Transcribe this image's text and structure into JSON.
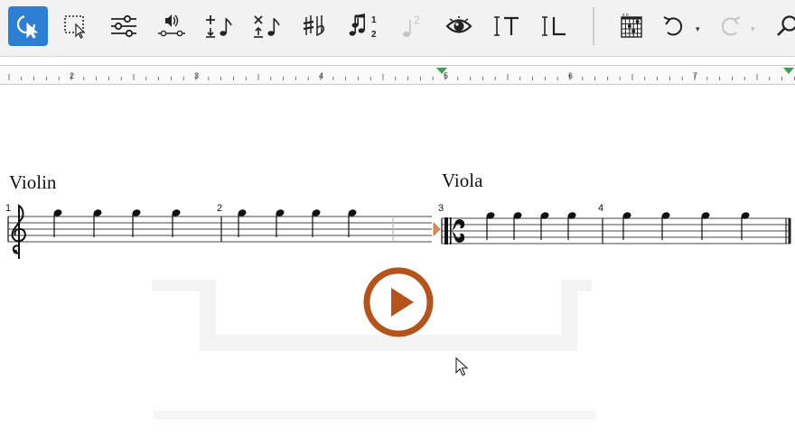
{
  "toolbar": {
    "tools": [
      {
        "name": "select-tool",
        "icon": "select-arrow-icon",
        "active": true
      },
      {
        "name": "range-select-tool",
        "icon": "range-select-icon"
      },
      {
        "name": "properties-tool",
        "icon": "sliders-icon"
      },
      {
        "name": "playback-tool",
        "icon": "speaker-icon"
      },
      {
        "name": "add-note-tool",
        "icon": "add-note-icon"
      },
      {
        "name": "remove-note-tool",
        "icon": "remove-note-icon"
      },
      {
        "name": "accidentals-tool",
        "icon": "accidentals-icon"
      },
      {
        "name": "voices-tool",
        "icon": "voices-icon",
        "labels": [
          "1",
          "2"
        ]
      },
      {
        "name": "voice-2-tool",
        "icon": "voice-2-icon",
        "disabled": true,
        "label": "2"
      },
      {
        "name": "visibility-tool",
        "icon": "eye-icon"
      },
      {
        "name": "text-tool",
        "icon": "text-insert-icon",
        "label": "T"
      },
      {
        "name": "lyrics-tool",
        "icon": "lyrics-insert-icon",
        "label": "L"
      },
      {
        "name": "chord-diagram-tool",
        "icon": "chord-grid-icon"
      },
      {
        "name": "undo-button",
        "icon": "undo-icon"
      },
      {
        "name": "redo-button",
        "icon": "redo-icon",
        "disabled": true
      },
      {
        "name": "search-button",
        "icon": "search-icon"
      }
    ],
    "caret": "▾"
  },
  "ruler": {
    "labels": [
      "2",
      "3",
      "4",
      "5",
      "6",
      "7"
    ],
    "marker_color": "#2ea84a"
  },
  "score": {
    "instruments": [
      "Violin",
      "Viola"
    ],
    "measure_numbers": [
      "1",
      "2",
      "3",
      "4"
    ],
    "play_overlay_color": "#b5531a"
  }
}
